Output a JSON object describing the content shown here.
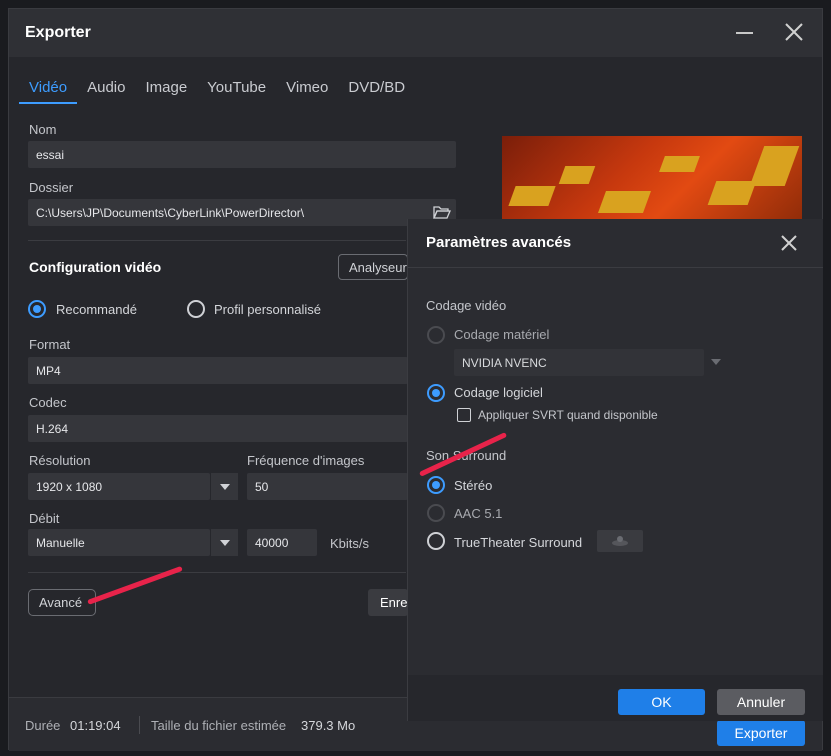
{
  "window": {
    "title": "Exporter"
  },
  "tabs": [
    {
      "label": "Vidéo",
      "active": true
    },
    {
      "label": "Audio",
      "active": false
    },
    {
      "label": "Image",
      "active": false
    },
    {
      "label": "YouTube",
      "active": false
    },
    {
      "label": "Vimeo",
      "active": false
    },
    {
      "label": "DVD/BD",
      "active": false
    }
  ],
  "form": {
    "name_label": "Nom",
    "name_value": "essai",
    "folder_label": "Dossier",
    "folder_value": "C:\\Users\\JP\\Documents\\CyberLink\\PowerDirector\\",
    "config_title": "Configuration vidéo",
    "analyzer_label": "Analyseur de",
    "recommended_label": "Recommandé",
    "custom_profile_label": "Profil personnalisé",
    "format_label": "Format",
    "format_value": "MP4",
    "codec_label": "Codec",
    "codec_value": "H.264",
    "resolution_label": "Résolution",
    "resolution_value": "1920 x 1080",
    "framerate_label": "Fréquence d'images",
    "framerate_value": "50",
    "bitrate_label": "Débit",
    "bitrate_mode_value": "Manuelle",
    "bitrate_value": "40000",
    "bitrate_unit": "Kbits/s",
    "advanced_label": "Avancé",
    "save_label": "Enre"
  },
  "footer": {
    "duration_label": "Durée",
    "duration_value": "01:19:04",
    "size_label": "Taille du fichier estimée",
    "size_value": "379.3 Mo",
    "export_label": "Exporter"
  },
  "dialog": {
    "title": "Paramètres avancés",
    "video_encoding_label": "Codage vidéo",
    "hardware_label": "Codage matériel",
    "hardware_device_value": "NVIDIA NVENC",
    "software_label": "Codage logiciel",
    "svrt_label": "Appliquer SVRT quand disponible",
    "surround_label": "Son Surround",
    "stereo_label": "Stéréo",
    "aac_label": "AAC 5.1",
    "truetheater_label": "TrueTheater Surround",
    "ok_label": "OK",
    "cancel_label": "Annuler"
  },
  "colors": {
    "accent": "#3d9cff",
    "primary_button": "#1f7fe8",
    "annotation_arrow": "#e8234a"
  }
}
